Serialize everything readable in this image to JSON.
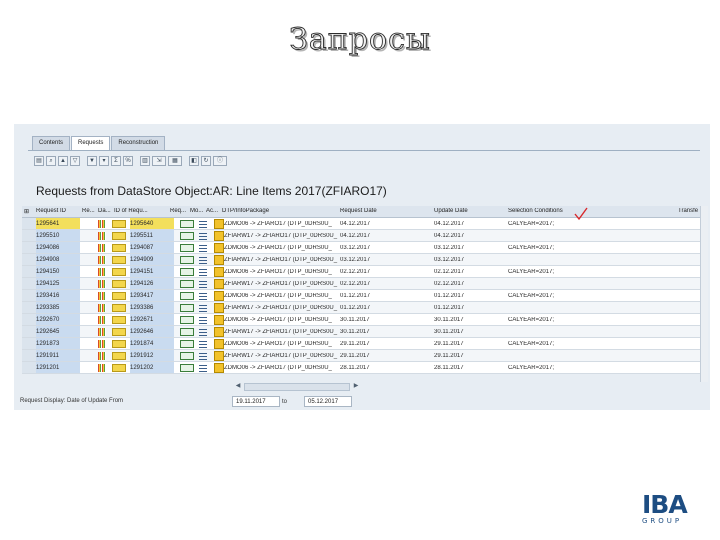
{
  "slide": {
    "title": "Запросы"
  },
  "tabs": [
    "Contents",
    "Requests",
    "Reconstruction"
  ],
  "panel_title": "Requests from DataStore Object:AR: Line Items 2017(ZFIARO17)",
  "columns": [
    "Request ID",
    "Re...",
    "Da...",
    "ID of Requ...",
    "Req...",
    "Mo...",
    "Ac...",
    "DTP/InfoPackage",
    "Request Date",
    "Update Date",
    "Selection Conditions",
    "Transfe"
  ],
  "rows": [
    {
      "req": "1295641",
      "id": "1295640",
      "pkg": "ZDMO06 -> ZFIARO17  (DTP_0DRS0U_",
      "rdate": "04.12.2017",
      "udate": "04.12.2017",
      "cond": "CALYEAR=2017;"
    },
    {
      "req": "1295510",
      "id": "1295511",
      "pkg": "ZFIARW17 -> ZFIARO17  (DTP_0DRS0U_",
      "rdate": "04.12.2017",
      "udate": "04.12.2017",
      "cond": ""
    },
    {
      "req": "1294086",
      "id": "1294087",
      "pkg": "ZDMO06 -> ZFIARO17  (DTP_0DRS0U_",
      "rdate": "03.12.2017",
      "udate": "03.12.2017",
      "cond": "CALYEAR=2017;"
    },
    {
      "req": "1294908",
      "id": "1294909",
      "pkg": "ZFIARW17 -> ZFIARO17  (DTP_0DRS0U_",
      "rdate": "03.12.2017",
      "udate": "03.12.2017",
      "cond": ""
    },
    {
      "req": "1294150",
      "id": "1294151",
      "pkg": "ZDMO06 -> ZFIARO17  (DTP_0DRS0U_",
      "rdate": "02.12.2017",
      "udate": "02.12.2017",
      "cond": "CALYEAR=2017;"
    },
    {
      "req": "1294125",
      "id": "1294126",
      "pkg": "ZFIARW17 -> ZFIARO17  (DTP_0DRS0U_",
      "rdate": "02.12.2017",
      "udate": "02.12.2017",
      "cond": ""
    },
    {
      "req": "1293416",
      "id": "1293417",
      "pkg": "ZDMO06 -> ZFIARO17  (DTP_0DRS0U_",
      "rdate": "01.12.2017",
      "udate": "01.12.2017",
      "cond": "CALYEAR=2017;"
    },
    {
      "req": "1293385",
      "id": "1293386",
      "pkg": "ZFIARW17 -> ZFIARO17  (DTP_0DRS0U_",
      "rdate": "01.12.2017",
      "udate": "01.12.2017",
      "cond": ""
    },
    {
      "req": "1292670",
      "id": "1292671",
      "pkg": "ZDMO06 -> ZFIARO17  (DTP_0DRS0U_",
      "rdate": "30.11.2017",
      "udate": "30.11.2017",
      "cond": "CALYEAR=2017;"
    },
    {
      "req": "1292645",
      "id": "1292646",
      "pkg": "ZFIARW17 -> ZFIARO17  (DTP_0DRS0U_",
      "rdate": "30.11.2017",
      "udate": "30.11.2017",
      "cond": ""
    },
    {
      "req": "1291873",
      "id": "1291874",
      "pkg": "ZDMO06 -> ZFIARO17  (DTP_0DRS0U_",
      "rdate": "29.11.2017",
      "udate": "29.11.2017",
      "cond": "CALYEAR=2017;"
    },
    {
      "req": "1291911",
      "id": "1291912",
      "pkg": "ZFIARW17 -> ZFIARO17  (DTP_0DRS0U_",
      "rdate": "29.11.2017",
      "udate": "29.11.2017",
      "cond": ""
    },
    {
      "req": "1291201",
      "id": "1291202",
      "pkg": "ZDMO06 -> ZFIARO17  (DTP_0DRS0U_",
      "rdate": "28.11.2017",
      "udate": "28.11.2017",
      "cond": "CALYEAR=2017;"
    }
  ],
  "status_bar": {
    "label": "Request Display: Date of Update From",
    "date_from": "19.11.2017",
    "to_label": "to",
    "date_to": "05.12.2017"
  },
  "logo": {
    "name": "IBA",
    "sub": "GROUP"
  },
  "colors": {
    "title_fill": "#f1f1f1",
    "title_stroke": "#2c2c2c",
    "logo_blue": "#1d4d82",
    "selected_row": "#f3df5c",
    "check_mark": "#d8282b"
  }
}
